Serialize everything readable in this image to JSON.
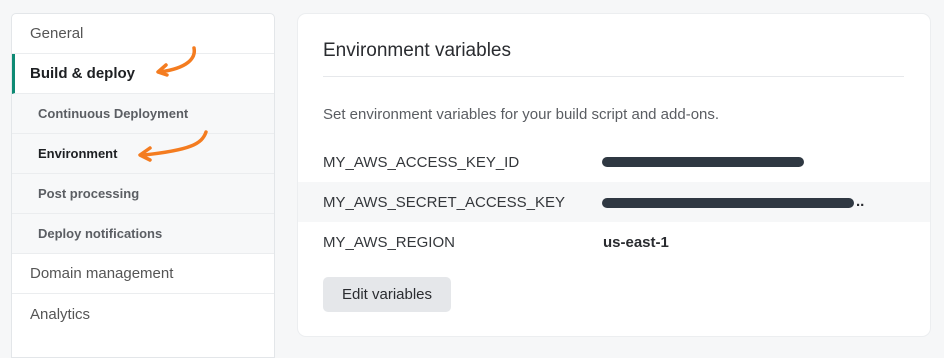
{
  "sidebar": {
    "items": [
      {
        "label": "General"
      },
      {
        "label": "Build & deploy"
      },
      {
        "label": "Continuous Deployment"
      },
      {
        "label": "Environment"
      },
      {
        "label": "Post processing"
      },
      {
        "label": "Deploy notifications"
      },
      {
        "label": "Domain management"
      },
      {
        "label": "Analytics"
      }
    ]
  },
  "main": {
    "title": "Environment variables",
    "description": "Set environment variables for your build script and add-ons.",
    "variables": [
      {
        "key": "MY_AWS_ACCESS_KEY_ID",
        "value": ""
      },
      {
        "key": "MY_AWS_SECRET_ACCESS_KEY",
        "value": ""
      },
      {
        "key": "MY_AWS_REGION",
        "value": "us-east-1"
      }
    ],
    "edit_button": "Edit variables"
  },
  "colors": {
    "accent": "#0e8a74",
    "annotation_arrow": "#f47c20",
    "redaction": "#2f3842"
  }
}
